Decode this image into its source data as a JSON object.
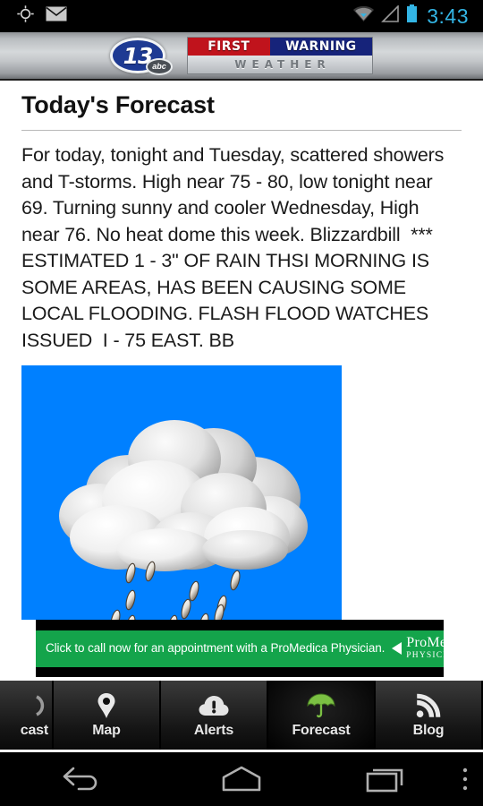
{
  "statusbar": {
    "time": "3:43",
    "icons": {
      "location": "location-crosshair-icon",
      "mail": "envelope-icon",
      "wifi": "wifi-icon",
      "signal": "cell-signal-icon",
      "battery": "battery-icon"
    },
    "accent_color": "#33b5e5",
    "background_color": "#000000"
  },
  "appheader": {
    "station_number": "13",
    "station_network": "abc",
    "brand_first": "FIRST",
    "brand_warning": "WARNING",
    "brand_weather": "WEATHER",
    "brand_first_color": "#c0131c",
    "brand_warning_color": "#16237a"
  },
  "main": {
    "page_title": "Today's Forecast",
    "forecast_text": "For today, tonight and Tuesday, scattered showers and T-storms. High near 75 - 80, low tonight near 69. Turning sunny and cooler Wednesday, High near 76. No heat dome this week. Blizzardbill  ***  ESTIMATED 1 - 3\" OF RAIN THSI MORNING IS SOME AREAS, HAS BEEN CAUSING SOME LOCAL FLOODING. FLASH FLOOD WATCHES ISSUED  I - 75 EAST. BB",
    "forecast_image": {
      "name": "rain-cloud-graphic",
      "background_color": "#0080ff"
    }
  },
  "ad": {
    "text": "Click to call now for an appointment with a ProMedica Physician.",
    "logo_main": "ProMedica",
    "logo_sub": "PHYSICIANS",
    "background_color": "#14a44b"
  },
  "tabbar": {
    "tabs": [
      {
        "label": "cast",
        "icon": "partial-tab-icon",
        "selected": false,
        "partial": true
      },
      {
        "label": "Map",
        "icon": "map-pin-icon",
        "selected": false,
        "partial": false
      },
      {
        "label": "Alerts",
        "icon": "alert-cloud-icon",
        "selected": false,
        "partial": false
      },
      {
        "label": "Forecast",
        "icon": "umbrella-icon",
        "selected": true,
        "partial": false
      },
      {
        "label": "Blog",
        "icon": "rss-icon",
        "selected": false,
        "partial": false
      }
    ],
    "selected_icon_color": "#7bc043"
  },
  "navbar": {
    "back": "back-icon",
    "home": "home-icon",
    "recents": "recents-icon",
    "menu": "overflow-menu-icon"
  }
}
